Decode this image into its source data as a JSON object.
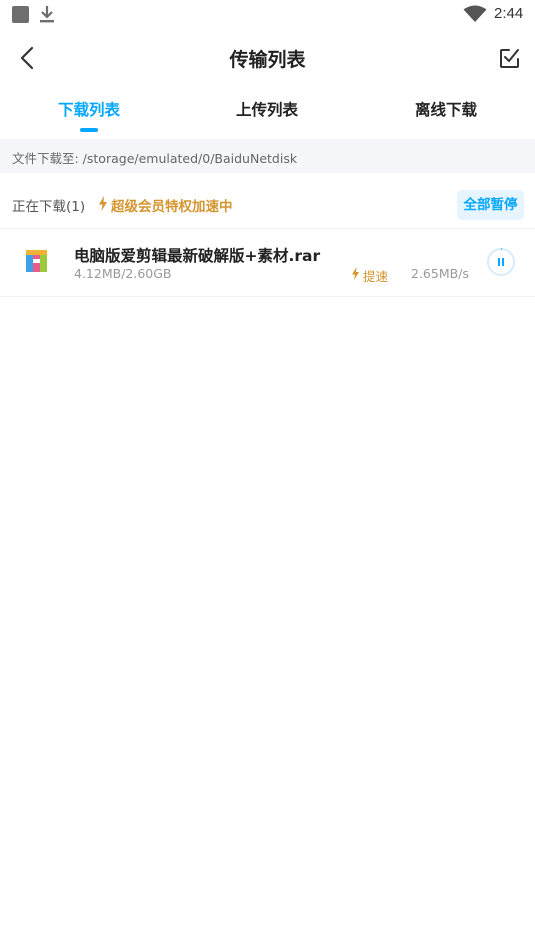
{
  "status_bar": {
    "time": "2:44",
    "icons": [
      "notification-square-icon",
      "download-icon",
      "wifi-icon"
    ]
  },
  "header": {
    "title": "传输列表",
    "back_icon": "chevron-left-icon",
    "edit_icon": "checkbox-edit-icon"
  },
  "tabs": [
    {
      "label": "下载列表",
      "active": true
    },
    {
      "label": "上传列表",
      "active": false
    },
    {
      "label": "离线下载",
      "active": false
    }
  ],
  "path_bar": {
    "text": "文件下载至: /storage/emulated/0/BaiduNetdisk"
  },
  "section": {
    "downloading_label": "正在下载(1)",
    "vip_text": "超级会员特权加速中",
    "pause_all_label": "全部暂停"
  },
  "downloads": [
    {
      "name": "电脑版爱剪辑最新破解版+素材.rar",
      "progress": "4.12MB/2.60GB",
      "boost_label": "提速",
      "speed": "2.65MB/s",
      "icon": "rar-archive-icon"
    }
  ],
  "colors": {
    "accent": "#06a7ff",
    "vip_gold": "#d4952e",
    "path_bg": "#f5f6f8",
    "pause_all_bg": "#e5f4ff"
  }
}
